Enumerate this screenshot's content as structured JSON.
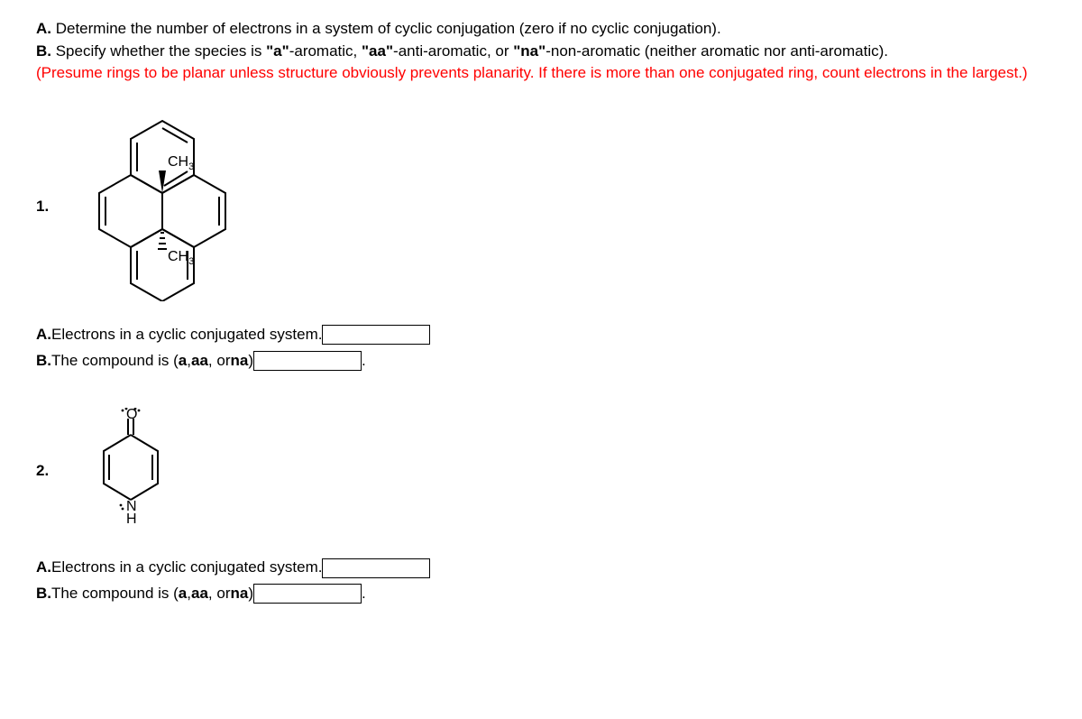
{
  "intro": {
    "lineA_label": "A.",
    "lineA_text": " Determine the number of electrons in a system of cyclic conjugation (zero if no cyclic conjugation).",
    "lineB_label": "B.",
    "lineB_text_1": " Specify whether the species is ",
    "q_a": "\"a\"",
    "t_a": "-aromatic, ",
    "q_aa": "\"aa\"",
    "t_aa": "-anti-aromatic, or ",
    "q_na": "\"na\"",
    "t_na": "-non-aromatic (neither aromatic nor anti-aromatic).",
    "red_text": "(Presume rings to be planar unless structure obviously prevents planarity. If there is more than one conjugated ring, count electrons in the largest.)"
  },
  "p1": {
    "number": "1.",
    "ch3_top": "CH",
    "ch3_top_sub": "3",
    "ch3_bot": "CH",
    "ch3_bot_sub": "3",
    "qA_bold": "A.",
    "qA_text": "Electrons in a cyclic conjugated system.",
    "qB_bold": "B.",
    "qB_text_1": "The compound is (",
    "qB_a": "a",
    "qB_c1": ", ",
    "qB_aa": "aa",
    "qB_c2": ", or ",
    "qB_na": "na",
    "qB_close": ")",
    "period": "."
  },
  "p2": {
    "number": "2.",
    "o_label": "O",
    "n_label": "N",
    "h_label": "H",
    "qA_bold": "A.",
    "qA_text": "Electrons in a cyclic conjugated system.",
    "qB_bold": "B.",
    "qB_text_1": "The compound is (",
    "qB_a": "a",
    "qB_c1": ", ",
    "qB_aa": "aa",
    "qB_c2": ", or ",
    "qB_na": "na",
    "qB_close": ")",
    "period": "."
  }
}
